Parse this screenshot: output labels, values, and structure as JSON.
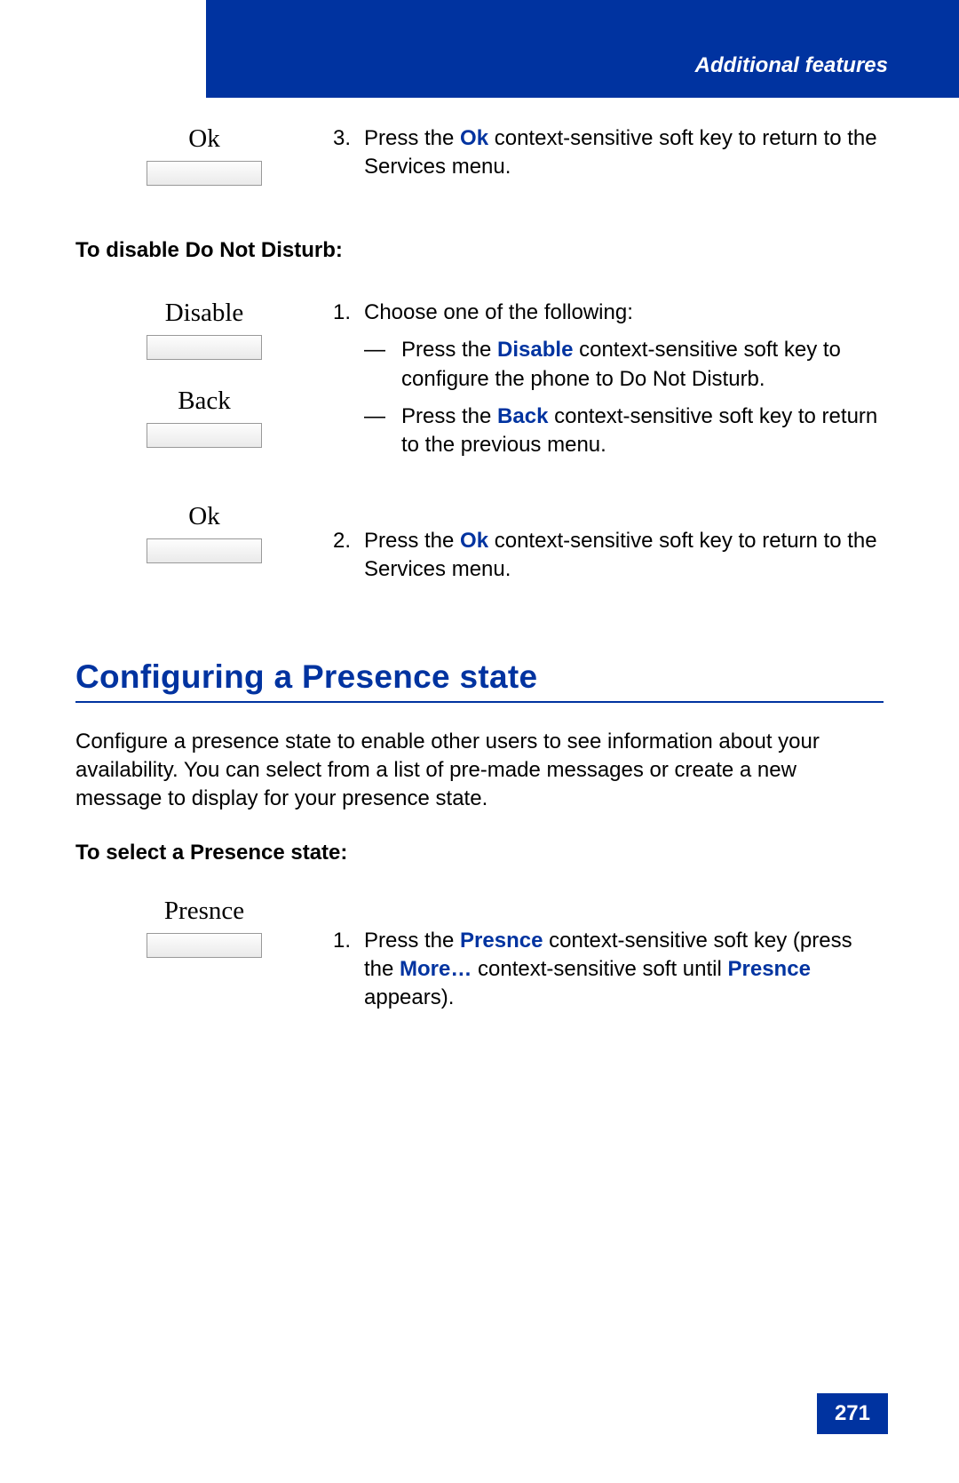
{
  "header": {
    "title": "Additional features"
  },
  "keys": {
    "ok1": "Ok",
    "disable": "Disable",
    "back": "Back",
    "ok2": "Ok",
    "presnce": "Presnce"
  },
  "step3": {
    "num": "3.",
    "pre": "Press the ",
    "key": "Ok",
    "post": " context-sensitive soft key to return to the Services menu."
  },
  "subheading_disable": "To disable Do Not Disturb:",
  "disable_step1": {
    "num": "1.",
    "intro": "Choose one of the following:",
    "opt1_pre": "Press the ",
    "opt1_key": "Disable",
    "opt1_post": " context-sensitive soft key to configure the phone to Do Not Disturb.",
    "opt2_pre": "Press the ",
    "opt2_key": "Back",
    "opt2_post": " context-sensitive soft key to return to the previous menu."
  },
  "disable_step2": {
    "num": "2.",
    "pre": "Press the ",
    "key": "Ok",
    "post": " context-sensitive soft key to return to the Services menu."
  },
  "section_title": "Configuring a Presence state",
  "section_para": "Configure a presence state to enable other users to see information about your availability. You can select from a list of pre-made messages or create a new message to display for your presence state.",
  "subheading_presence": "To select a Presence state:",
  "presence_step1": {
    "num": "1.",
    "pre": "Press the ",
    "key1": "Presnce",
    "mid1": " context-sensitive soft key (press the ",
    "key2": "More…",
    "mid2": " context-sensitive soft until ",
    "key3": "Presnce",
    "post": " appears)."
  },
  "dash": "—",
  "page_number": "271"
}
